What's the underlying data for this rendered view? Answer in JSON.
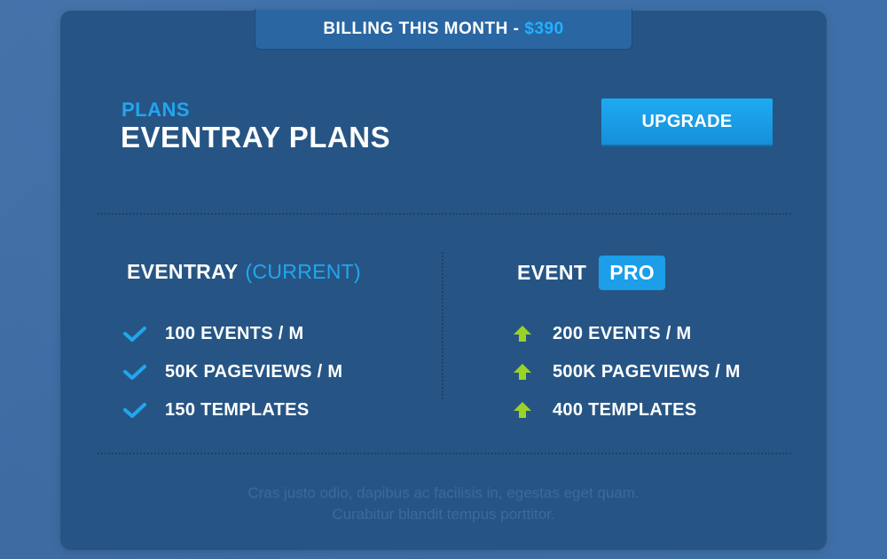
{
  "billing": {
    "label": "BILLING THIS MONTH -",
    "amount": "$390"
  },
  "header": {
    "kicker": "PLANS",
    "title": "EVENTRAY PLANS",
    "upgrade_label": "UPGRADE"
  },
  "current_plan": {
    "name": "EVENTRAY",
    "tag": "(CURRENT)",
    "features": [
      "100 EVENTS / M",
      "50K PAGEVIEWS / M",
      "150 TEMPLATES"
    ],
    "feature_icon": "check-icon"
  },
  "pro_plan": {
    "name": "EVENT",
    "badge": "PRO",
    "features": [
      "200 EVENTS / M",
      "500K PAGEVIEWS / M",
      "400 TEMPLATES"
    ],
    "feature_icon": "arrow-up-icon"
  },
  "footer": {
    "line1": "Cras justo odio, dapibus ac facilisis in, egestas eget quam.",
    "line2": "Curabitur blandit tempus porttitor."
  },
  "colors": {
    "background": "#3f6fa8",
    "card": "#265585",
    "accent": "#22a6ee",
    "check": "#22a6ee",
    "arrow": "#9ad22a"
  }
}
